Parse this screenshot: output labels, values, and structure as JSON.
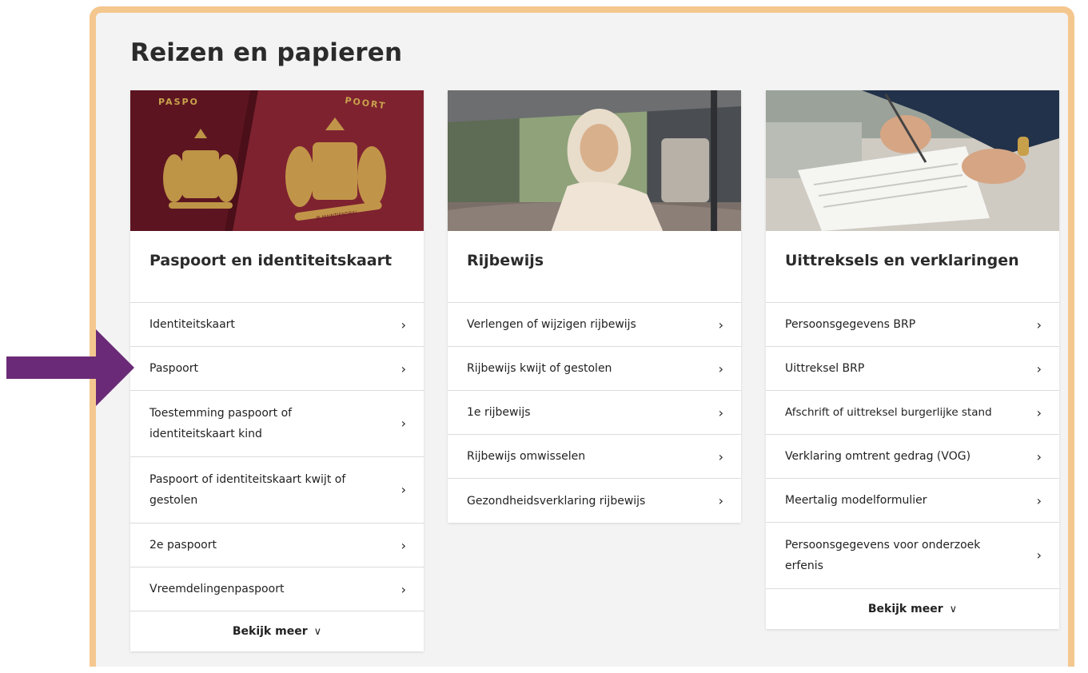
{
  "section": {
    "title": "Reizen en papieren"
  },
  "cards": [
    {
      "title": "Paspoort en identiteitskaart",
      "image_text": {
        "left": "PASPO",
        "right": "POORT",
        "motto": "JE MAINTIENDRAI"
      },
      "links": [
        {
          "label": "Identiteitskaart"
        },
        {
          "label": "Paspoort"
        },
        {
          "label": "Toestemming paspoort of identiteitskaart kind"
        },
        {
          "label": "Paspoort of identiteitskaart kwijt of gestolen"
        },
        {
          "label": "2e paspoort"
        },
        {
          "label": "Vreemdelingenpaspoort"
        }
      ],
      "more_label": "Bekijk meer"
    },
    {
      "title": "Rijbewijs",
      "links": [
        {
          "label": "Verlengen of wijzigen rijbewijs"
        },
        {
          "label": "Rijbewijs kwijt of gestolen"
        },
        {
          "label": "1e rijbewijs"
        },
        {
          "label": "Rijbewijs omwisselen"
        },
        {
          "label": "Gezondheidsverklaring rijbewijs"
        }
      ]
    },
    {
      "title": "Uittreksels en verklaringen",
      "links": [
        {
          "label": "Persoonsgegevens BRP"
        },
        {
          "label": "Uittreksel BRP"
        },
        {
          "label": "Afschrift of uittreksel burgerlijke stand"
        },
        {
          "label": "Verklaring omtrent gedrag (VOG)"
        },
        {
          "label": "Meertalig modelformulier"
        },
        {
          "label": "Persoonsgegevens voor onderzoek erfenis"
        }
      ],
      "more_label": "Bekijk meer"
    }
  ],
  "icons": {
    "link_chevron": "chevron-right-icon",
    "more_chevron": "chevron-down-icon",
    "pointer": "arrow-right-icon"
  },
  "colors": {
    "frame": "#f4c78f",
    "panel": "#f3f3f3",
    "arrow": "#6b2a77",
    "passport": "#7a1f2c"
  }
}
